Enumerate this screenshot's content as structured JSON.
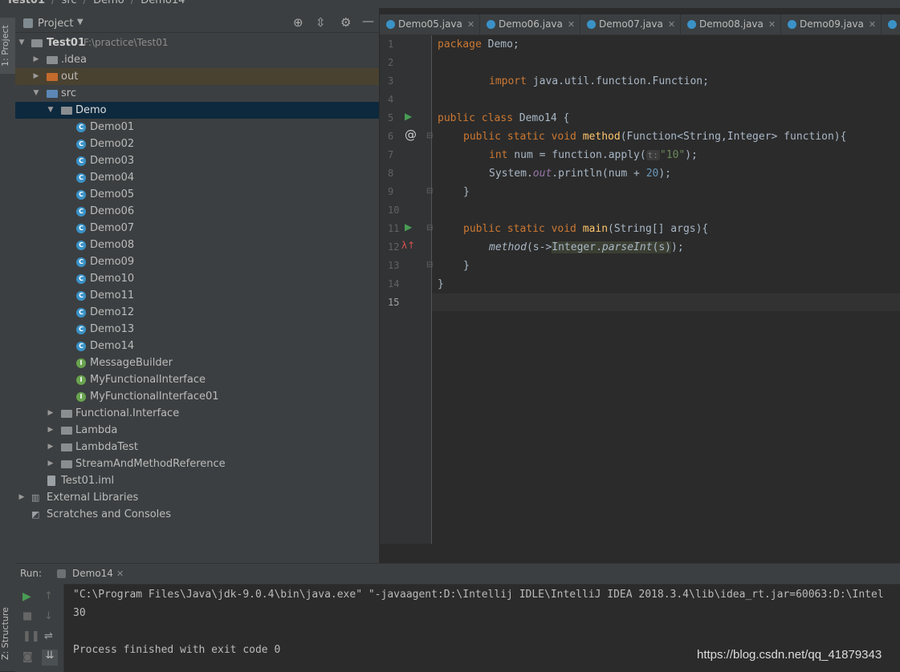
{
  "breadcrumb": {
    "project": "Test01",
    "folder": "src",
    "package": "Demo",
    "file": "Demo14"
  },
  "left_strip": {
    "project_tab": "1: Project",
    "structure_tab": "Z: Structure"
  },
  "project_panel": {
    "title": "Project",
    "root": {
      "name": "Test01",
      "path": "F:\\practice\\Test01"
    },
    "items": [
      {
        "label": ".idea",
        "kind": "folder"
      },
      {
        "label": "out",
        "kind": "folder-out"
      },
      {
        "label": "src",
        "kind": "folder-src"
      },
      {
        "label": "Demo",
        "kind": "package"
      },
      {
        "label": "Demo01",
        "kind": "class"
      },
      {
        "label": "Demo02",
        "kind": "class"
      },
      {
        "label": "Demo03",
        "kind": "class"
      },
      {
        "label": "Demo04",
        "kind": "class"
      },
      {
        "label": "Demo05",
        "kind": "class"
      },
      {
        "label": "Demo06",
        "kind": "class"
      },
      {
        "label": "Demo07",
        "kind": "class"
      },
      {
        "label": "Demo08",
        "kind": "class"
      },
      {
        "label": "Demo09",
        "kind": "class"
      },
      {
        "label": "Demo10",
        "kind": "class"
      },
      {
        "label": "Demo11",
        "kind": "class"
      },
      {
        "label": "Demo12",
        "kind": "class"
      },
      {
        "label": "Demo13",
        "kind": "class"
      },
      {
        "label": "Demo14",
        "kind": "class"
      },
      {
        "label": "MessageBuilder",
        "kind": "interface"
      },
      {
        "label": "MyFunctionalInterface",
        "kind": "interface"
      },
      {
        "label": "MyFunctionalInterface01",
        "kind": "interface"
      },
      {
        "label": "Functional.Interface",
        "kind": "package"
      },
      {
        "label": "Lambda",
        "kind": "package"
      },
      {
        "label": "LambdaTest",
        "kind": "package"
      },
      {
        "label": "StreamAndMethodReference",
        "kind": "package"
      },
      {
        "label": "Test01.iml",
        "kind": "file"
      },
      {
        "label": "External Libraries",
        "kind": "library"
      },
      {
        "label": "Scratches and Consoles",
        "kind": "scratch"
      }
    ]
  },
  "tabs": [
    "Demo05.java",
    "Demo06.java",
    "Demo07.java",
    "Demo08.java",
    "Demo09.java"
  ],
  "editor": {
    "line_numbers": [
      "1",
      "2",
      "3",
      "4",
      "5",
      "6",
      "7",
      "8",
      "9",
      "10",
      "11",
      "12",
      "13",
      "14",
      "15"
    ],
    "code": {
      "l1_kw": "package",
      "l1_rest": " Demo;",
      "l3_kw": "import",
      "l3_rest": " java.util.function.Function;",
      "l5_kw": "public class",
      "l5_rest": " Demo14 {",
      "l6_kw": "public static void",
      "l6_fn": "method",
      "l6_rest": "(Function<String,Integer> function){",
      "l7_kw": "int",
      "l7_a": " num = function.apply(",
      "l7_hint": "t:",
      "l7_str": "\"10\"",
      "l7_b": ");",
      "l8_a": "System.",
      "l8_out": "out",
      "l8_b": ".println(num + ",
      "l8_num": "20",
      "l8_c": ");",
      "l9": "}",
      "l11_kw": "public static void",
      "l11_fn": "main",
      "l11_rest": "(String[] args){",
      "l12_m": "method",
      "l12_a": "(s->",
      "l12_hl": "Integer.",
      "l12_pi": "parseInt",
      "l12_hl2": "(s)",
      "l12_b": ");",
      "l13": "}",
      "l14": "}"
    }
  },
  "run_panel": {
    "label": "Run:",
    "tab": "Demo14",
    "lines": [
      "\"C:\\Program Files\\Java\\jdk-9.0.4\\bin\\java.exe\" \"-javaagent:D:\\Intellij IDLE\\IntelliJ IDEA 2018.3.4\\lib\\idea_rt.jar=60063:D:\\Intel",
      "30",
      "",
      "Process finished with exit code 0"
    ]
  },
  "watermark": "https://blog.csdn.net/qq_41879343",
  "colors": {
    "bg": "#2b2b2b",
    "panel": "#3c3f41",
    "keyword": "#cc7832",
    "method": "#ffc66d",
    "number": "#6897bb",
    "string": "#6a8759",
    "selection": "#0d293e"
  }
}
